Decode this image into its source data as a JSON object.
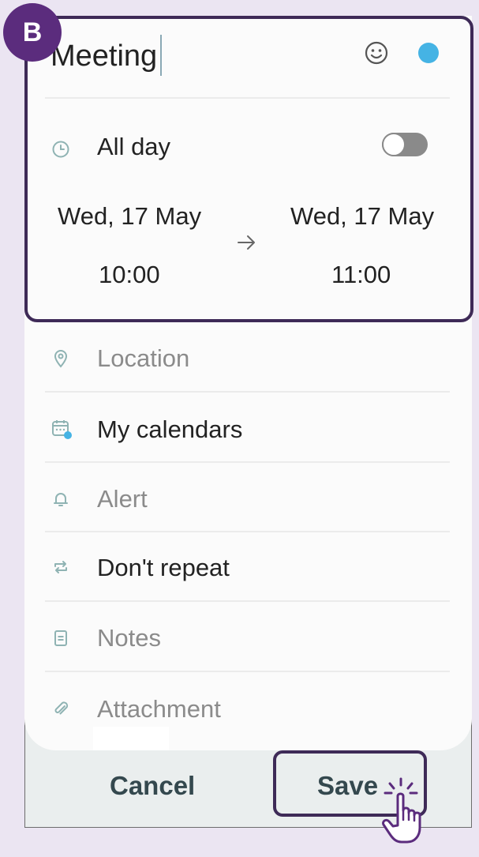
{
  "badge": {
    "letter": "B"
  },
  "event": {
    "title": "Meeting"
  },
  "colors": {
    "accent_dot": "#45b3e4",
    "highlight": "#3e2a57",
    "badge": "#5b2c7d"
  },
  "all_day": {
    "label": "All day",
    "enabled": false
  },
  "start": {
    "date": "Wed, 17 May",
    "time": "10:00"
  },
  "end": {
    "date": "Wed, 17 May",
    "time": "11:00"
  },
  "fields": {
    "location": "Location",
    "calendar": "My calendars",
    "alert": "Alert",
    "repeat": "Don't repeat",
    "notes": "Notes",
    "attachment": "Attachment"
  },
  "icons": {
    "emoji": "smiley-icon",
    "clock": "clock-icon",
    "location": "location-pin-icon",
    "calendar": "calendar-icon",
    "alert": "bell-icon",
    "repeat": "repeat-icon",
    "notes": "notes-icon",
    "attachment": "paperclip-icon",
    "arrow": "arrow-right-icon",
    "pointer": "hand-pointer-icon"
  },
  "buttons": {
    "cancel": "Cancel",
    "save": "Save"
  }
}
